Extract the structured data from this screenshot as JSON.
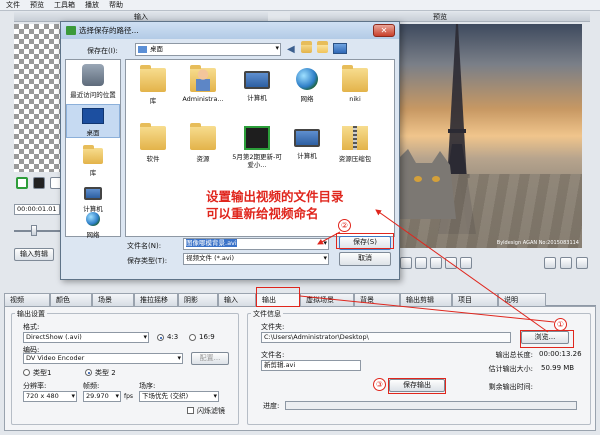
{
  "menu": [
    "文件",
    "预览",
    "工具箱",
    "播放",
    "帮助"
  ],
  "panels": {
    "input": "输入",
    "preview": "预览"
  },
  "timecode": "00:00:01.01",
  "input_edit_label": "输入剪辑",
  "preview_credit": "Byldesign AGAN No:2015083114",
  "tabs": [
    "视频",
    "颜色",
    "场景",
    "推拉摇移",
    "阴影",
    "输入",
    "输出",
    "虚拟场景",
    "背景",
    "输出剪辑",
    "项目",
    "说明"
  ],
  "active_tab": "输出",
  "output": {
    "settings_title": "输出设置",
    "format_label": "格式:",
    "format_value": "DirectShow (.avi)",
    "ratio_a": "4:3",
    "ratio_b": "16:9",
    "codec_label": "编码:",
    "codec_value": "DV Video Encoder",
    "config_button": "配置...",
    "type1": "类型1",
    "type2": "类型 2",
    "resolution_label": "分辨率:",
    "resolution_value": "720 x 480",
    "fps_label": "帧频:",
    "fps_value": "29.970",
    "fps_unit": "fps",
    "field_label": "场序:",
    "field_value": "下场优先 (交织)",
    "flicker_filter": "闪烁滤镜",
    "file_info_title": "文件信息",
    "folder_label": "文件夹:",
    "folder_value": "C:\\Users\\Administrator\\Desktop\\",
    "browse_button": "浏览...",
    "filename_label": "文件名:",
    "filename_value": "新剪辑.avi",
    "total_length_label": "输出总长度:",
    "total_length_value": "00:00:13.26",
    "est_size_label": "估计输出大小:",
    "est_size_value": "50.99 MB",
    "save_output_button": "保存输出",
    "remaining_label": "剩余输出时间:",
    "remaining_value": "",
    "progress_label": "进度:",
    "progress": 0
  },
  "dialog": {
    "title": "选择保存的路径...",
    "save_in_label": "保存在(I):",
    "save_in_value": "桌面",
    "places": [
      "最近访问的位置",
      "桌面",
      "库",
      "计算机",
      "网络"
    ],
    "selected_place": "桌面",
    "files": [
      {
        "name": "库",
        "icon": "library-folder-icon"
      },
      {
        "name": "Administra...",
        "icon": "user-folder-icon"
      },
      {
        "name": "计算机",
        "icon": "computer-icon"
      },
      {
        "name": "网络",
        "icon": "network-icon"
      },
      {
        "name": "niki",
        "icon": "folder-icon"
      },
      {
        "name": "软件",
        "icon": "folder-icon"
      },
      {
        "name": "资源",
        "icon": "folder-icon"
      },
      {
        "name": "5月第2期更新-可爱小...",
        "icon": "video-file-icon"
      },
      {
        "name": "计算机",
        "icon": "computer-icon"
      },
      {
        "name": "资源压缩包",
        "icon": "zip-folder-icon"
      }
    ],
    "filename_label": "文件名(N):",
    "filename_value": "图像哪模背景.avi",
    "filetype_label": "保存类型(T):",
    "filetype_value": "视频文件 (*.avi)",
    "save_button": "保存(S)",
    "cancel_button": "取消"
  },
  "annotation": {
    "line1": "设置输出视频的文件目录",
    "line2": "可以重新给视频命名",
    "step1": "①",
    "step2": "②",
    "step3": "③"
  },
  "colors": {
    "annotation": "#e0261d",
    "dialog_bg": "#dce6f2"
  }
}
